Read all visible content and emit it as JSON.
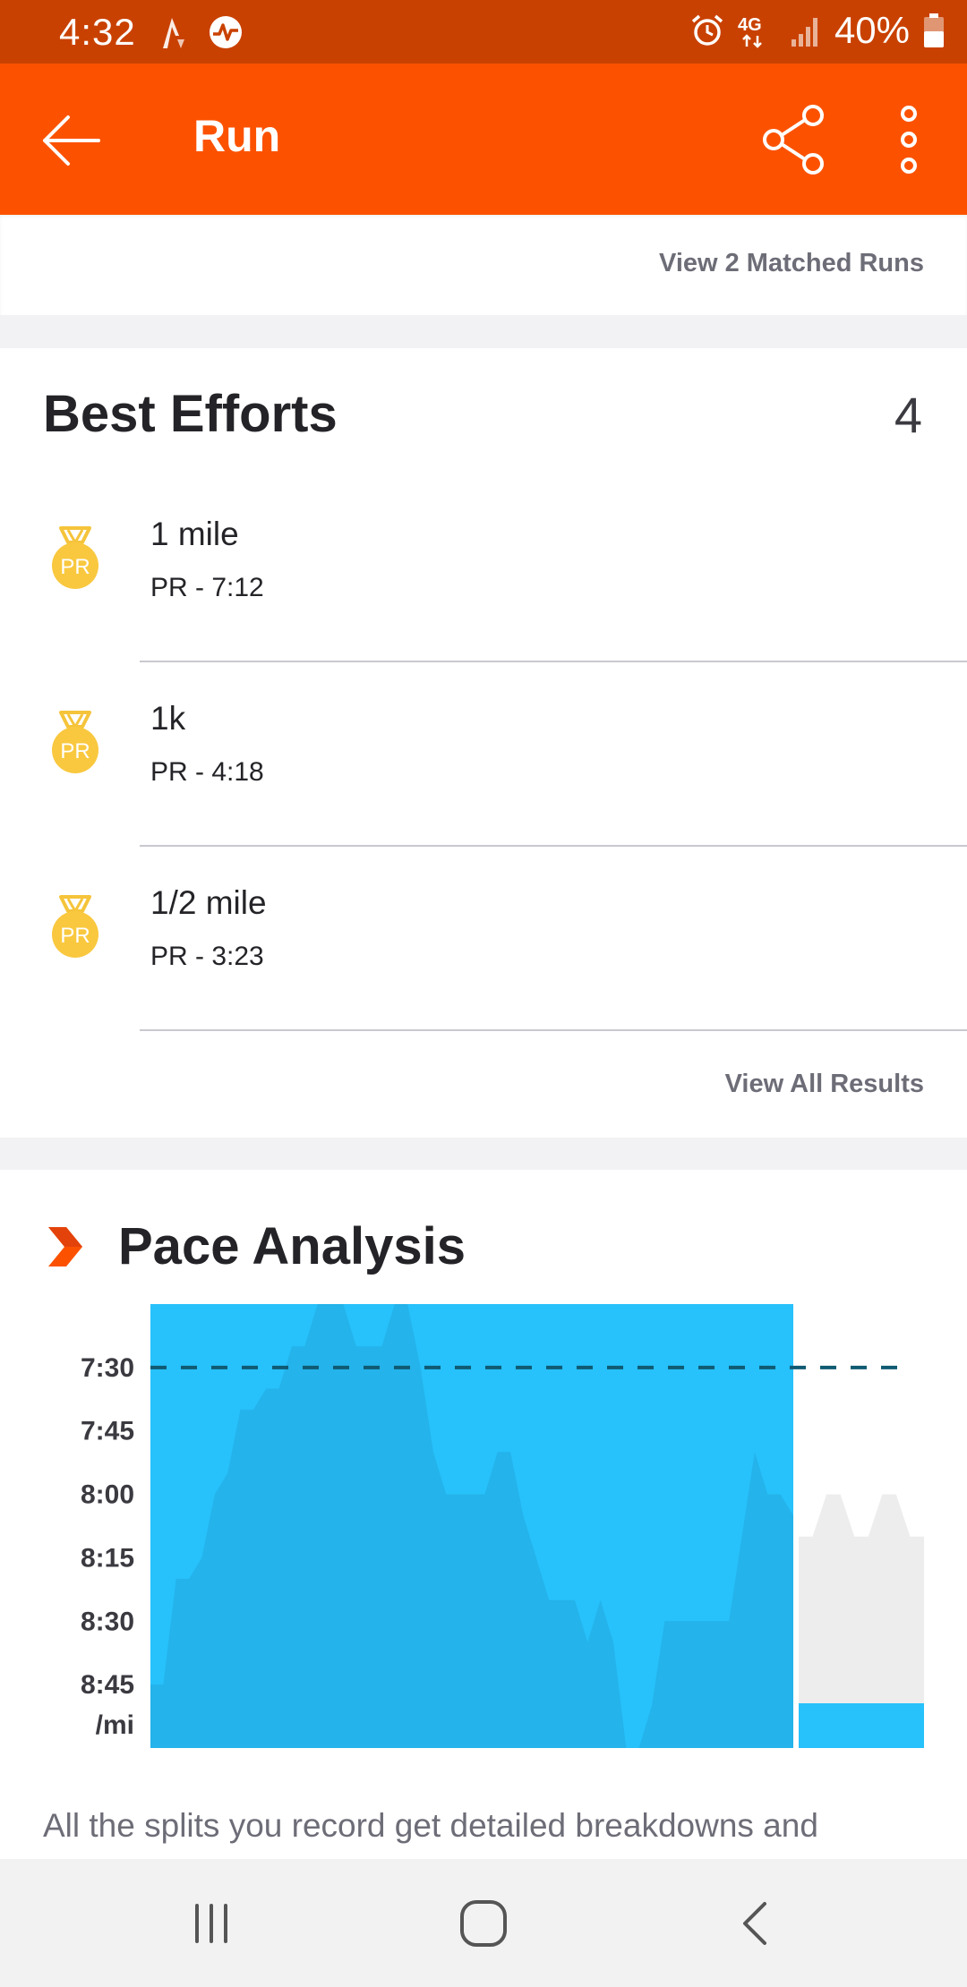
{
  "status_bar": {
    "time": "4:32",
    "battery": "40%",
    "network": "4G",
    "icons": [
      "strava-notification-icon",
      "activity-notification-icon",
      "alarm-icon",
      "network-4g-icon",
      "signal-icon",
      "battery-icon"
    ]
  },
  "app_bar": {
    "title": "Run",
    "back_icon": "arrow-left-icon",
    "share_icon": "share-icon",
    "more_icon": "more-vertical-icon"
  },
  "matched_runs": {
    "link_label": "View 2 Matched Runs"
  },
  "best_efforts": {
    "title": "Best Efforts",
    "count": "4",
    "medal_label": "PR",
    "items": [
      {
        "name": "1 mile",
        "result": "PR - 7:12"
      },
      {
        "name": "1k",
        "result": "PR - 4:18"
      },
      {
        "name": "1/2 mile",
        "result": "PR - 3:23"
      }
    ],
    "view_all_label": "View All Results"
  },
  "pace_analysis": {
    "title": "Pace Analysis",
    "description": "All the splits you record get detailed breakdowns and",
    "colors": {
      "accent": "#fc5200",
      "bar": "#27c1fb",
      "bar_inner": "#24b3ea",
      "bar_dim": "#ededed",
      "reference_line": "#0f5a72"
    }
  },
  "chart_data": {
    "type": "area",
    "title": "Pace Analysis",
    "ylabel": "/mi",
    "y_tick_labels": [
      "7:30",
      "7:45",
      "8:00",
      "8:15",
      "8:30",
      "8:45"
    ],
    "y_unit_label": "/mi",
    "ylim": [
      "7:15",
      "9:00"
    ],
    "reference_pace": "7:30",
    "series": [
      {
        "values": [
          "8:45",
          "8:45",
          "8:20",
          "8:20",
          "8:15",
          "8:00",
          "7:55",
          "7:40",
          "7:40",
          "7:35",
          "7:35",
          "7:25",
          "7:25",
          "7:15",
          "7:15",
          "7:15",
          "7:25",
          "7:25",
          "7:25",
          "7:15",
          "7:15",
          "7:30",
          "7:50",
          "8:00",
          "8:00",
          "8:00",
          "8:00",
          "7:50",
          "7:50",
          "8:05",
          "8:15",
          "8:25",
          "8:25",
          "8:25",
          "8:35",
          "8:25",
          "8:35",
          "9:00",
          "9:00",
          "8:50",
          "8:30",
          "8:30",
          "8:30",
          "8:30",
          "8:30",
          "8:30",
          "8:10",
          "7:50",
          "8:00",
          "8:00",
          "8:05"
        ]
      },
      {
        "values": [
          "8:10",
          "8:10",
          "8:00",
          "8:00",
          "8:10",
          "8:10",
          "8:00",
          "8:00",
          "8:10",
          "8:10"
        ]
      }
    ],
    "grid": false,
    "legend": "none"
  },
  "nav_bar": {
    "recents_icon": "recents-icon",
    "home_icon": "home-icon",
    "back_icon": "nav-back-icon"
  }
}
